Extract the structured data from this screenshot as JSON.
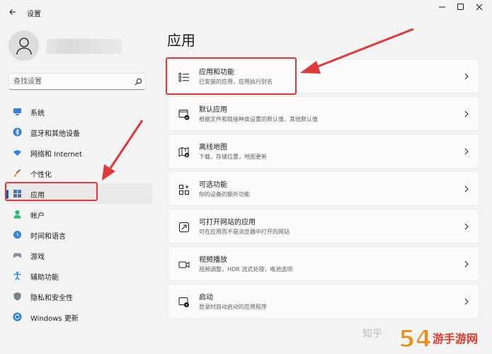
{
  "window": {
    "title": "设置"
  },
  "search": {
    "placeholder": "查找设置"
  },
  "sidebar": {
    "items": [
      {
        "label": "系统",
        "icon": "display-icon"
      },
      {
        "label": "蓝牙和其他设备",
        "icon": "bluetooth-icon"
      },
      {
        "label": "网络和 Internet",
        "icon": "wifi-icon"
      },
      {
        "label": "个性化",
        "icon": "brush-icon"
      },
      {
        "label": "应用",
        "icon": "apps-icon",
        "active": true
      },
      {
        "label": "帐户",
        "icon": "account-icon"
      },
      {
        "label": "时间和语言",
        "icon": "globe-clock-icon"
      },
      {
        "label": "游戏",
        "icon": "gamepad-icon"
      },
      {
        "label": "辅助功能",
        "icon": "accessibility-icon"
      },
      {
        "label": "隐私和安全性",
        "icon": "shield-icon"
      },
      {
        "label": "Windows 更新",
        "icon": "update-icon"
      }
    ]
  },
  "main": {
    "title": "应用",
    "cards": [
      {
        "title": "应用和功能",
        "subtitle": "已安装的应用，应用执行别名",
        "icon": "list-icon"
      },
      {
        "title": "默认应用",
        "subtitle": "根据文件和链接种类设置的默认值，其他默认值",
        "icon": "default-apps-icon"
      },
      {
        "title": "离线地图",
        "subtitle": "下载，存储位置，地图更新",
        "icon": "offline-map-icon"
      },
      {
        "title": "可选功能",
        "subtitle": "你的设备的额外功能",
        "icon": "grid-plus-icon"
      },
      {
        "title": "可打开网站的应用",
        "subtitle": "可在应用而不是浏览器中打开的网站",
        "icon": "open-link-icon"
      },
      {
        "title": "视频播放",
        "subtitle": "视频调整，HDR 流式处理，电池选项",
        "icon": "video-icon"
      },
      {
        "title": "启动",
        "subtitle": "登录时自动启动的应用程序",
        "icon": "startup-icon"
      }
    ]
  },
  "colors": {
    "accent": "#005fb8",
    "annotation": "#e0393a"
  },
  "watermark": {
    "text": "知乎",
    "logo_text": "54游手游网"
  }
}
